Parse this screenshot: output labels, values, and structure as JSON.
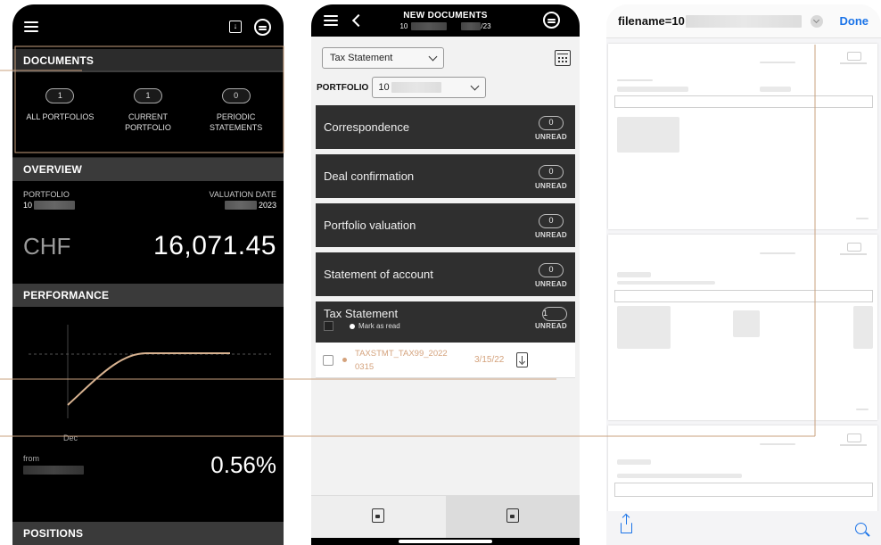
{
  "phone1": {
    "documents": {
      "heading": "DOCUMENTS",
      "items": [
        {
          "count": "1",
          "label_line1": "ALL PORTFOLIOS",
          "label_line2": ""
        },
        {
          "count": "1",
          "label_line1": "CURRENT",
          "label_line2": "PORTFOLIO"
        },
        {
          "count": "0",
          "label_line1": "PERIODIC",
          "label_line2": "STATEMENTS"
        }
      ]
    },
    "overview": {
      "heading": "OVERVIEW",
      "portfolio_label": "PORTFOLIO",
      "portfolio_value": "10",
      "valuation_label": "VALUATION DATE",
      "valuation_value": "2023",
      "currency": "CHF",
      "amount": "16,071.45"
    },
    "performance": {
      "heading": "PERFORMANCE",
      "x_label": "Dec",
      "from_label": "from",
      "percent": "0.56%"
    },
    "positions": {
      "heading": "POSITIONS"
    }
  },
  "phone2": {
    "title": "NEW DOCUMENTS",
    "subtitle_left": "10",
    "subtitle_right": "/23",
    "type_select": "Tax Statement",
    "portfolio_label": "PORTFOLIO",
    "portfolio_value": "10",
    "unread_label": "UNREAD",
    "categories": [
      {
        "name": "Correspondence",
        "count": "0"
      },
      {
        "name": "Deal confirmation",
        "count": "0"
      },
      {
        "name": "Portfolio valuation",
        "count": "0"
      },
      {
        "name": "Statement of account",
        "count": "0"
      }
    ],
    "tax": {
      "name": "Tax Statement",
      "count": "1",
      "mark_as_read": "Mark as read"
    },
    "document": {
      "name_line1": "TAXSTMT_TAX99_2022",
      "name_line2": "0315",
      "date": "3/15/22"
    }
  },
  "phone3": {
    "filename": "filename=10",
    "done_label": "Done"
  },
  "colors": {
    "accent": "#d4a27c",
    "ios_blue": "#1a73e8",
    "section_grey": "#3a3a3a"
  }
}
